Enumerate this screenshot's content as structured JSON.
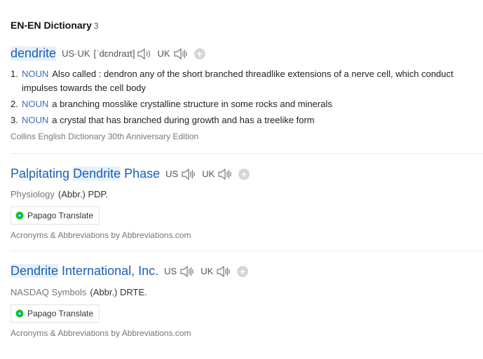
{
  "section": {
    "title": "EN-EN Dictionary",
    "count": "3"
  },
  "entry1": {
    "headword": "dendrite",
    "us_uk_label": "US·UK",
    "ipa": "[ˈdɛndraɪt]",
    "uk_label": "UK",
    "add": "+",
    "definitions": [
      {
        "num": "1.",
        "pos": "NOUN",
        "text": "Also called : dendron any of the short branched threadlike extensions of a nerve cell, which conduct impulses towards the cell body"
      },
      {
        "num": "2.",
        "pos": "NOUN",
        "text": "a branching mosslike crystalline structure in some rocks and minerals"
      },
      {
        "num": "3.",
        "pos": "NOUN",
        "text": "a crystal that has branched during growth and has a treelike form"
      }
    ],
    "source": "Collins English Dictionary 30th Anniversary Edition"
  },
  "entry2": {
    "head_part1": "Palpitating ",
    "head_hl": "Dendrite",
    "head_part2": " Phase",
    "us_label": "US",
    "uk_label": "UK",
    "add": "+",
    "category": "Physiology",
    "abbr": "(Abbr.) PDP.",
    "translate": "Papago Translate",
    "source": "Acronyms & Abbreviations by Abbreviations.com"
  },
  "entry3": {
    "head_hl": "Dendrite",
    "head_part2": " International, Inc.",
    "us_label": "US",
    "uk_label": "UK",
    "add": "+",
    "category": "NASDAQ Symbols",
    "abbr": "(Abbr.) DRTE.",
    "translate": "Papago Translate",
    "source": "Acronyms & Abbreviations by Abbreviations.com"
  },
  "icons": {
    "speaker": "speaker-icon",
    "plus": "plus-circle-icon",
    "papago": "papago-logo-icon"
  },
  "colors": {
    "headword": "#1a5fb4",
    "pos": "#3d6fb5",
    "highlight": "#e8f1fb",
    "papago_green": "#1ec800"
  }
}
